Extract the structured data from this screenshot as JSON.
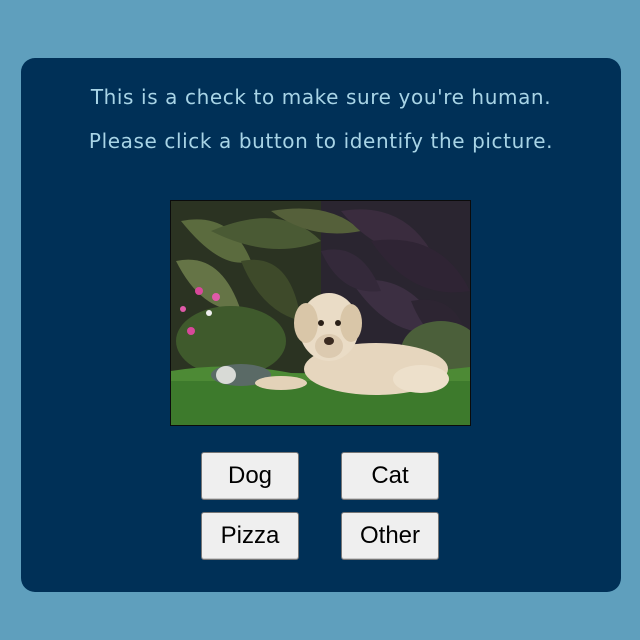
{
  "captcha": {
    "line1": "This is a check to make sure you're human.",
    "line2": "Please click a button to identify the picture.",
    "image_subject": "dog lying on grass in a garden",
    "buttons": {
      "dog": "Dog",
      "cat": "Cat",
      "pizza": "Pizza",
      "other": "Other"
    }
  },
  "colors": {
    "page_background": "#5f9fbd",
    "card_background": "#003057",
    "text": "#a8d4e6",
    "button_background": "#efefef"
  }
}
